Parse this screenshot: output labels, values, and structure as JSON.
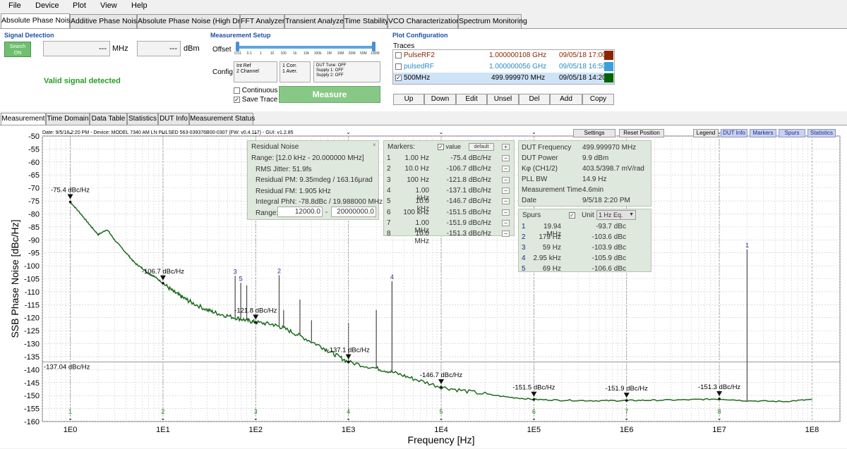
{
  "menu": {
    "file": "File",
    "device": "Device",
    "plot": "Plot",
    "view": "View",
    "help": "Help"
  },
  "main_tabs": [
    "Absolute Phase Noise",
    "Additive Phase Noise",
    "Absolute Phase Noise (High Drift)",
    "FFT Analyzer",
    "Transient Analyzer",
    "Time Stability",
    "VCO Characterization",
    "Spectrum Monitoring"
  ],
  "signal_detection": {
    "title": "Signal Detection",
    "search_button": "Search\nON",
    "freq_value": "---",
    "freq_unit": "MHz",
    "power_value": "---",
    "power_unit": "dBm",
    "status": "Valid signal detected"
  },
  "measurement_setup": {
    "title": "Measurement Setup",
    "offset_label": "Offset",
    "offset_ticks": [
      "0.01",
      "0.1",
      "1",
      "10",
      "100",
      "1k",
      "10k",
      "100k",
      "1M",
      "10M",
      "20M",
      "50M",
      "100M"
    ],
    "config_label": "Config",
    "config_buttons": [
      "Int Ref\n2 Channel",
      "1 Corr.\n1 Aver.",
      "DUT Tune: OFF\nSupply 1: OFF\nSupply 2: OFF"
    ],
    "continuous_label": "Continuous",
    "save_trace_label": "Save Trace",
    "measure_button": "Measure"
  },
  "plot_configuration": {
    "title": "Plot Configuration",
    "traces_label": "Traces",
    "traces": [
      {
        "name": "PulseRF2",
        "freq": "1.000000108 GHz",
        "date": "09/05/18 17:00",
        "color": "#8b2500",
        "text_color": "#8b2500",
        "checked": false
      },
      {
        "name": "pulsedRF",
        "freq": "1.000000056 GHz",
        "date": "09/05/18 16:50",
        "color": "#3aa0d8",
        "text_color": "#2a8bc7",
        "checked": false
      },
      {
        "name": "500MHz",
        "freq": "499.999970 MHz",
        "date": "09/05/18 14:20",
        "color": "#006400",
        "text_color": "#000000",
        "checked": true
      }
    ],
    "buttons": [
      "Up",
      "Down",
      "Edit",
      "Unsel",
      "Del",
      "Add",
      "Copy"
    ]
  },
  "sub_tabs": [
    "Measurement",
    "Time Domain",
    "Data Table",
    "Statistics",
    "DUT Info",
    "Measurement Status"
  ],
  "plot_header": "Date: 9/5/18 2:20 PM - Device: MODEL 7340 AM LN PULSED 563-039376B00-0307 (FW: v0.4.117) - GUI: v1.2.85",
  "plot_buttons_left": [
    "Settings",
    "Reset Position"
  ],
  "plot_buttons_right": [
    "Legend",
    "DUT Info",
    "Markers",
    "Spurs",
    "Statistics"
  ],
  "residual_noise": {
    "title": "Residual Noise",
    "range_line": "Range: [12.0 kHz - 20.000000 MHz]",
    "rms_jitter": "RMS Jitter: 51.9fs",
    "residual_pm": "Residual PM: 9.35mdeg / 163.16µrad",
    "residual_fm": "Residual FM: 1.905 kHz",
    "integral_phn": "Integral PhN: -78.8dBc / 19.988000 MHz",
    "range_label": "Range:",
    "range_from": "12000.0",
    "range_dash": "-",
    "range_to": "20000000.0"
  },
  "markers_panel": {
    "title": "Markers:",
    "value_label": "value",
    "default_button": "default",
    "add_symbol": "+",
    "remove_symbol": "−",
    "rows": [
      {
        "n": "1",
        "f": "1.00 Hz",
        "v": "-75.4 dBc/Hz"
      },
      {
        "n": "2",
        "f": "10.0 Hz",
        "v": "-106.7 dBc/Hz"
      },
      {
        "n": "3",
        "f": "100 Hz",
        "v": "-121.8 dBc/Hz"
      },
      {
        "n": "4",
        "f": "1.00 kHz",
        "v": "-137.1 dBc/Hz"
      },
      {
        "n": "5",
        "f": "10.0 kHz",
        "v": "-146.7 dBc/Hz"
      },
      {
        "n": "6",
        "f": "100 kHz",
        "v": "-151.5 dBc/Hz"
      },
      {
        "n": "7",
        "f": "1.00 MHz",
        "v": "-151.9 dBc/Hz"
      },
      {
        "n": "8",
        "f": "10.0 MHz",
        "v": "-151.3 dBc/Hz"
      }
    ]
  },
  "dut_info": {
    "rows": [
      {
        "k": "DUT Frequency",
        "v": "499.999970 MHz"
      },
      {
        "k": "DUT Power",
        "v": "9.9 dBm"
      },
      {
        "k": "Kφ (CH1/2)",
        "v": "403.5/398.7 mV/rad"
      },
      {
        "k": "PLL BW",
        "v": "14.9 Hz"
      },
      {
        "k": "Measurement Time",
        "v": "4.6min"
      },
      {
        "k": "Date",
        "v": "9/5/18 2:20 PM"
      }
    ]
  },
  "spurs": {
    "title": "Spurs",
    "unit_label": "Unit",
    "unit_value": "1 Hz Eq.",
    "rows": [
      {
        "n": "1",
        "f": "19.94 MHz",
        "v": "-93.7 dBc"
      },
      {
        "n": "2",
        "f": "179 Hz",
        "v": "-103.6 dBc"
      },
      {
        "n": "3",
        "f": "59 Hz",
        "v": "-103.9 dBc"
      },
      {
        "n": "4",
        "f": "2.95 kHz",
        "v": "-105.9 dBc"
      },
      {
        "n": "5",
        "f": "69 Hz",
        "v": "-106.6 dBc"
      }
    ]
  },
  "chart_data": {
    "type": "line",
    "xscale": "log",
    "xlim": [
      0.5,
      200000000
    ],
    "ylim": [
      -160,
      -50
    ],
    "xlabel": "Frequency [Hz]",
    "ylabel": "SSB Phase Noise [dBc/Hz]",
    "yticks": [
      "-50",
      "-55",
      "-60",
      "-65",
      "-70",
      "-75",
      "-80",
      "-85",
      "-90",
      "-95",
      "-100",
      "-105",
      "-110",
      "-115",
      "-120",
      "-125",
      "-130",
      "-135",
      "-140",
      "-145",
      "-150",
      "-155",
      "-160"
    ],
    "xtick_labels": [
      "1E0",
      "1E1",
      "1E2",
      "1E3",
      "1E4",
      "1E5",
      "1E6",
      "1E7",
      "1E8"
    ],
    "line_color": "#1e6b1e",
    "series": [
      {
        "x": [
          1,
          1.3,
          1.6,
          2,
          2.5,
          3,
          4,
          5,
          6,
          7,
          8,
          10,
          13,
          16,
          20,
          30,
          40,
          60,
          80,
          100,
          150,
          200,
          300,
          500,
          700,
          1000,
          2000,
          3000,
          5000,
          10000,
          20000,
          50000,
          100000,
          200000,
          500000,
          1000000,
          2000000,
          5000000,
          10000000,
          20000000,
          50000000,
          100000000
        ],
        "y": [
          -75.4,
          -80,
          -84,
          -88,
          -86,
          -90,
          -95,
          -99,
          -101,
          -103,
          -104,
          -106.7,
          -110,
          -112,
          -114,
          -117,
          -118.5,
          -120,
          -121,
          -121.8,
          -122.5,
          -124,
          -127,
          -131,
          -134,
          -137.1,
          -139.5,
          -141,
          -143.5,
          -146.7,
          -148.5,
          -150.5,
          -151.5,
          -151.8,
          -152,
          -151.9,
          -151.8,
          -151.6,
          -151.3,
          -152,
          -152.3,
          -151.5
        ]
      }
    ],
    "spur_lines": [
      {
        "x": 60,
        "y": -103.9,
        "label": "3"
      },
      {
        "x": 69,
        "y": -106.6,
        "label": "5"
      },
      {
        "x": 80,
        "y": -107.5,
        "label": ""
      },
      {
        "x": 179,
        "y": -103.6,
        "label": "2"
      },
      {
        "x": 200,
        "y": -117,
        "label": ""
      },
      {
        "x": 300,
        "y": -113,
        "label": ""
      },
      {
        "x": 400,
        "y": -121,
        "label": ""
      },
      {
        "x": 1000,
        "y": -122,
        "label": ""
      },
      {
        "x": 2000,
        "y": -117,
        "label": ""
      },
      {
        "x": 2950,
        "y": -105.9,
        "label": "4"
      },
      {
        "x": 19940000,
        "y": -93.7,
        "label": "1"
      }
    ],
    "markers": [
      {
        "x": 1,
        "y": -75.4,
        "label": "-75.4 dBc/Hz",
        "n": "1"
      },
      {
        "x": 10,
        "y": -106.7,
        "label": "-106.7 dBc/Hz",
        "n": "2"
      },
      {
        "x": 100,
        "y": -121.8,
        "label": "-121.8 dBc/Hz",
        "n": "3"
      },
      {
        "x": 1000,
        "y": -137.1,
        "label": "-137.1 dBc/Hz",
        "n": "4"
      },
      {
        "x": 10000,
        "y": -146.7,
        "label": "-146.7 dBc/Hz",
        "n": "5"
      },
      {
        "x": 100000,
        "y": -151.5,
        "label": "-151.5 dBc/Hz",
        "n": "6"
      },
      {
        "x": 1000000,
        "y": -151.9,
        "label": "-151.9 dBc/Hz",
        "n": "7"
      },
      {
        "x": 10000000,
        "y": -151.3,
        "label": "-151.3 dBc/Hz",
        "n": "8"
      }
    ],
    "hline": {
      "y": -137.04,
      "label": "-137.04 dBc/Hz"
    }
  }
}
